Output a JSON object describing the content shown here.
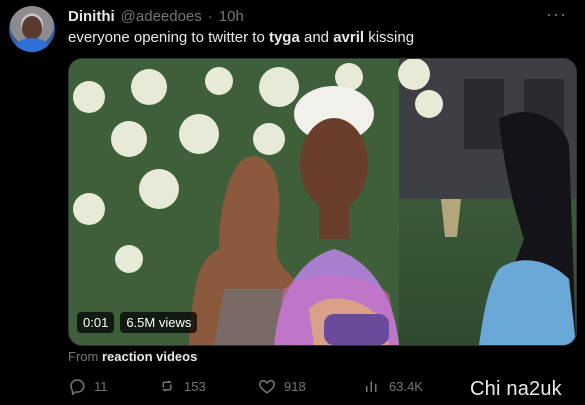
{
  "author": {
    "name": "Dinithi",
    "handle": "@adeedoes",
    "dot": "·",
    "time": "10h"
  },
  "tweet": {
    "parts": [
      {
        "t": "everyone opening to twitter to ",
        "b": false
      },
      {
        "t": "tyga",
        "b": true
      },
      {
        "t": " and ",
        "b": false
      },
      {
        "t": "avril",
        "b": true
      },
      {
        "t": " kissing",
        "b": false
      }
    ]
  },
  "media": {
    "time": "0:01",
    "views": "6.5M views"
  },
  "from": {
    "prefix": "From ",
    "source": "reaction videos"
  },
  "actions": {
    "replies": "11",
    "retweets": "153",
    "likes": "918",
    "views": "63.4K"
  },
  "watermark": "Chi na2uk",
  "more_icon": "more-dots-icon",
  "colors": {
    "bg": "#000000",
    "text": "#e7e9ea",
    "muted": "#71767b"
  }
}
